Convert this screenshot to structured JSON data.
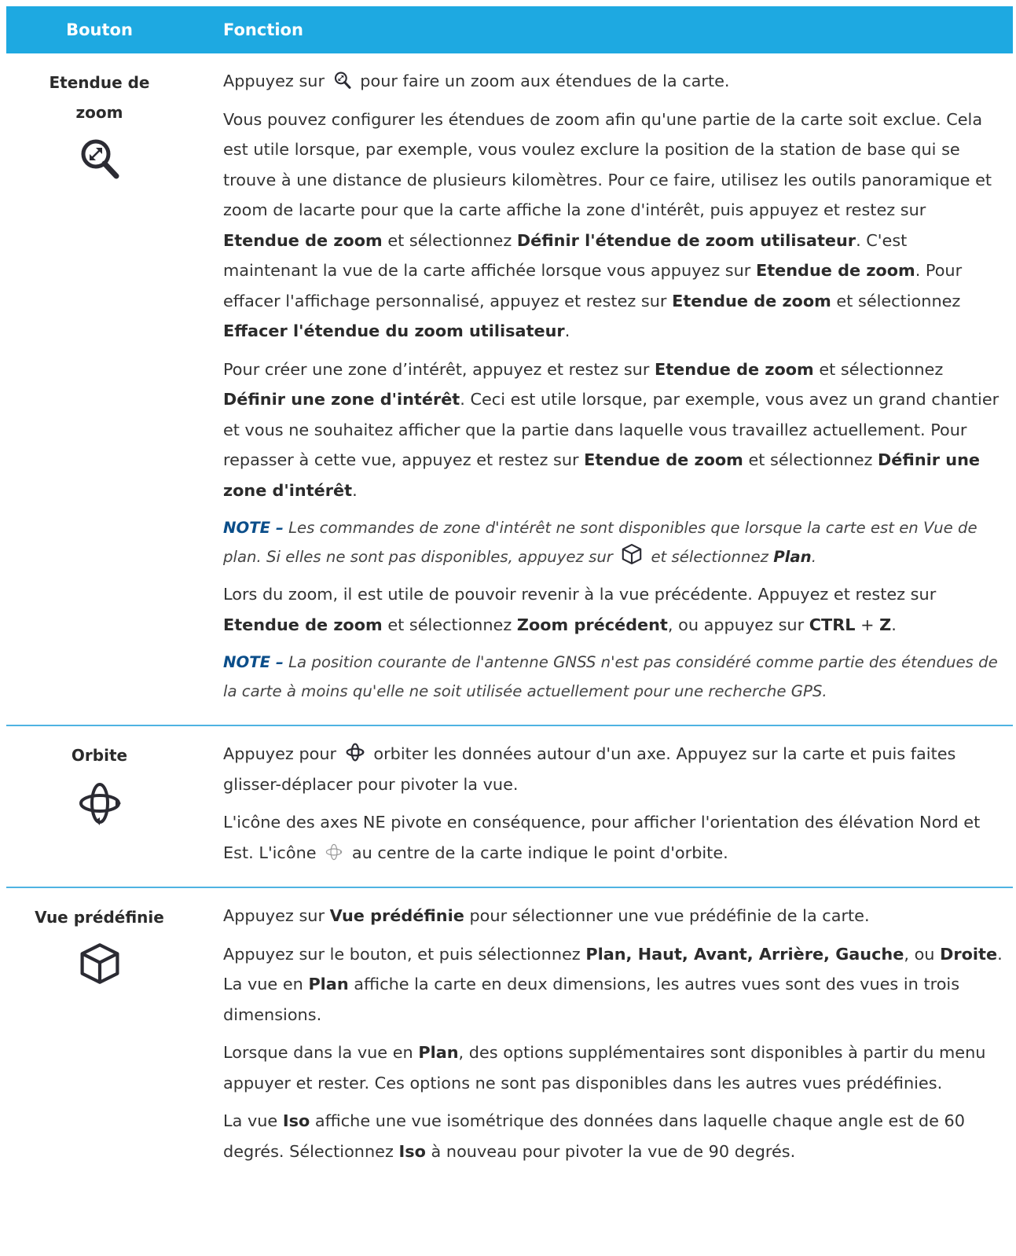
{
  "header": {
    "col1": "Bouton",
    "col2": "Fonction"
  },
  "rows": [
    {
      "name_line1": "Etendue de",
      "name_line2": "zoom",
      "icon": "zoom-extents-icon",
      "p1": {
        "before": "Appuyez sur",
        "after": "pour faire un zoom aux étendues de la carte."
      },
      "p2": {
        "t1": "Vous pouvez configurer les étendues de zoom afin qu'une partie de la carte soit exclue. Cela est utile lorsque, par exemple, vous voulez exclure la position de la station de base qui se trouve à une distance de plusieurs kilomètres. Pour ce faire, utilisez les outils panoramique et zoom de lacarte pour que la carte affiche la zone d'intérêt, puis appuyez et restez sur",
        "b1": "Etendue de zoom",
        "t2": "et sélectionnez",
        "b2": "Définir l'étendue de zoom utilisateur",
        "t3": ". C'est maintenant la vue de la carte affichée lorsque vous appuyez sur",
        "b3": "Etendue de zoom",
        "t4": ". Pour effacer l'affichage personnalisé, appuyez et restez sur",
        "b4": "Etendue de zoom",
        "t5": "et sélectionnez",
        "b5": "Effacer l'étendue du zoom utilisateur",
        "t6": "."
      },
      "p3": {
        "t1": "Pour créer une zone d’intérêt, appuyez et restez sur",
        "b1": "Etendue de zoom",
        "t2": "et sélectionnez",
        "b2": "Définir une zone d'intérêt",
        "t3": ". Ceci est utile lorsque, par exemple, vous avez un grand chantier et vous ne souhaitez afficher que la partie dans laquelle vous travaillez actuellement. Pour repasser à cette vue, appuyez et restez sur",
        "b3": "Etendue de zoom",
        "t4": "et sélectionnez",
        "b4": "Définir une zone d'intérêt",
        "t5": "."
      },
      "note1": {
        "label": "NOTE –",
        "t1": "Les commandes de zone d'intérêt ne sont disponibles que lorsque la carte est en Vue de plan. Si elles ne sont pas disponibles, appuyez sur",
        "t2": "et sélectionnez",
        "b1": "Plan",
        "t3": "."
      },
      "p4": {
        "t1": "Lors du zoom, il est utile de pouvoir revenir à la vue précédente. Appuyez et restez sur",
        "b1": "Etendue de zoom",
        "t2": "et sélectionnez",
        "b2": "Zoom précédent",
        "t3": ", ou appuyez sur",
        "b3": "CTRL",
        "t4": "+",
        "b4": "Z",
        "t5": "."
      },
      "note2": {
        "label": "NOTE –",
        "text": "La position courante de l'antenne GNSS n'est pas considéré comme partie des étendues de la carte à moins qu'elle ne soit utilisée actuellement pour une recherche GPS."
      }
    },
    {
      "name": "Orbite",
      "icon": "orbit-icon",
      "p1": {
        "before": "Appuyez pour",
        "after": "orbiter les données autour d'un axe. Appuyez sur la carte et puis faites glisser-déplacer pour pivoter la vue."
      },
      "p2": {
        "before": "L'icône des axes NE pivote en conséquence, pour afficher l'orientation des élévation Nord et Est. L'icône",
        "after": "au centre de la carte indique le point d'orbite."
      }
    },
    {
      "name": "Vue prédéfinie",
      "icon": "cube-icon",
      "p1": {
        "t1": "Appuyez sur",
        "b1": "Vue prédéfinie",
        "t2": "pour sélectionner une vue prédéfinie de la carte."
      },
      "p2": {
        "t1": "Appuyez sur le bouton, et puis sélectionnez",
        "b1": "Plan, Haut, Avant, Arrière, Gauche",
        "t2": ", ou",
        "b2": "Droite",
        "t3": ". La vue en",
        "b3": "Plan",
        "t4": "affiche la carte en deux dimensions, les autres vues sont des vues in trois dimensions."
      },
      "p3": {
        "t1": "Lorsque dans la vue en",
        "b1": "Plan",
        "t2": ", des options supplémentaires sont disponibles à partir du menu appuyer et rester. Ces options ne sont pas disponibles dans les autres vues prédéfinies."
      },
      "p4": {
        "t1": "La vue",
        "b1": "Iso",
        "t2": "affiche une vue isométrique des données dans laquelle chaque angle est de 60 degrés. Sélectionnez",
        "b2": "Iso",
        "t3": "à nouveau pour pivoter la vue de 90 degrés."
      }
    }
  ],
  "colors": {
    "header_bg": "#1ea9e1",
    "divider": "#4fb3e2",
    "note_label": "#0b4e8a"
  }
}
